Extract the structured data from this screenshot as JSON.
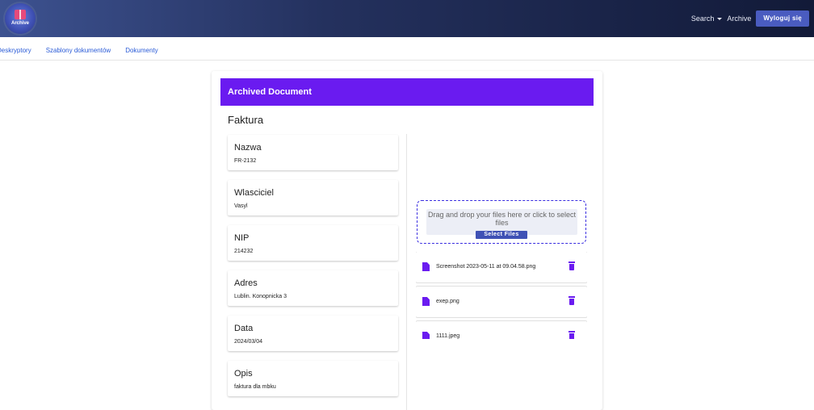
{
  "app": {
    "logo_text": "Archive",
    "colors": {
      "topbar_start": "#3d5290",
      "topbar_end": "#121a38",
      "accent": "#6a1bf0",
      "button": "#4a5cc0"
    }
  },
  "topnav": {
    "search_label": "Search",
    "archive_label": "Archive",
    "logout_label": "Wyloguj się"
  },
  "subnav": {
    "items": [
      "Deskryptory",
      "Szablony dokumentów",
      "Dokumenty"
    ]
  },
  "card": {
    "header": "Archived Document",
    "doc_title": "Faktura",
    "fields": [
      {
        "label": "Nazwa",
        "value": "FR-2132"
      },
      {
        "label": "Wlasciciel",
        "value": "Vasyl"
      },
      {
        "label": "NIP",
        "value": "214232"
      },
      {
        "label": "Adres",
        "value": "Lublin. Konopnicka 3"
      },
      {
        "label": "Data",
        "value": "2024/03/04"
      },
      {
        "label": "Opis",
        "value": "faktura dla mbku"
      }
    ]
  },
  "dropzone": {
    "text": "Drag and drop your files here or click to select files",
    "button": "Select Files"
  },
  "files": [
    {
      "name": "Screenshot 2023-05-11 at 09.04.58.png",
      "icon": "file-icon"
    },
    {
      "name": "exep.png",
      "icon": "file-icon"
    },
    {
      "name": "1111.jpeg",
      "icon": "file-icon"
    }
  ]
}
